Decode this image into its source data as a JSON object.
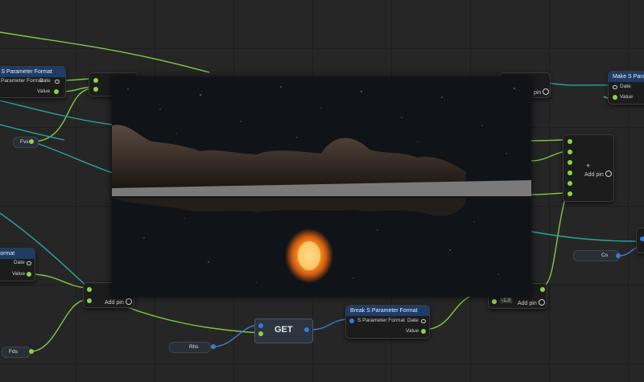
{
  "nodes": {
    "break_top_left": {
      "title": "k S Parameter Format",
      "pin_date": "Date",
      "pin_value": "Value",
      "partial_text": "Parameter Format"
    },
    "make_top_right": {
      "title": "Make S Parame",
      "pin_date": "Date",
      "pin_value": "Value"
    },
    "fvs_var": {
      "label": "Fvs"
    },
    "format_left": {
      "title": "Format",
      "pin_date": "Date",
      "pin_value": "Value"
    },
    "add_node_left": {
      "add_pin": "Add pin"
    },
    "fds_var": {
      "label": "Fds"
    },
    "rhs_var": {
      "label": "Rhs"
    },
    "get_node": {
      "label": "GET"
    },
    "break_bottom": {
      "title": "Break S Parameter Format",
      "input_label": "S Parameter Format",
      "pin_date": "Date",
      "pin_value": "Value"
    },
    "add_node_bottom_right": {
      "add_pin": "Add pin",
      "value": "-1.0"
    },
    "add_node_right": {
      "add_pin": "Add pin",
      "plus": "+"
    },
    "cs_var": {
      "label": "Cs"
    },
    "top_mid_right": {
      "add_pin": "pin"
    }
  },
  "colors": {
    "data_pin": "#8bd34a",
    "struct_pin": "#3a7bd5",
    "wire_green": "#7ec843",
    "wire_teal": "#2aa39a",
    "wire_blue": "#3a7bd5"
  }
}
